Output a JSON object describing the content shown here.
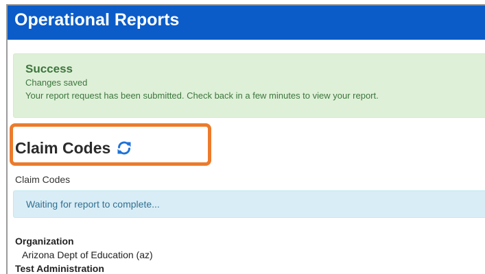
{
  "header": {
    "title": "Operational Reports"
  },
  "success_alert": {
    "title": "Success",
    "line1": "Changes saved",
    "line2": "Your report request has been submitted. Check back in a few minutes to view your report."
  },
  "report": {
    "title": "Claim Codes",
    "refresh_icon": "refresh-icon",
    "subtitle": "Claim Codes",
    "status": "Waiting for report to complete..."
  },
  "details": {
    "organization_label": "Organization",
    "organization_value": "Arizona Dept of Education (az)",
    "test_admin_label": "Test Administration"
  },
  "colors": {
    "header_bg": "#0b5cc8",
    "success_bg": "#dff0d8",
    "info_bg": "#d9edf7",
    "highlight": "#ec7b2c"
  }
}
